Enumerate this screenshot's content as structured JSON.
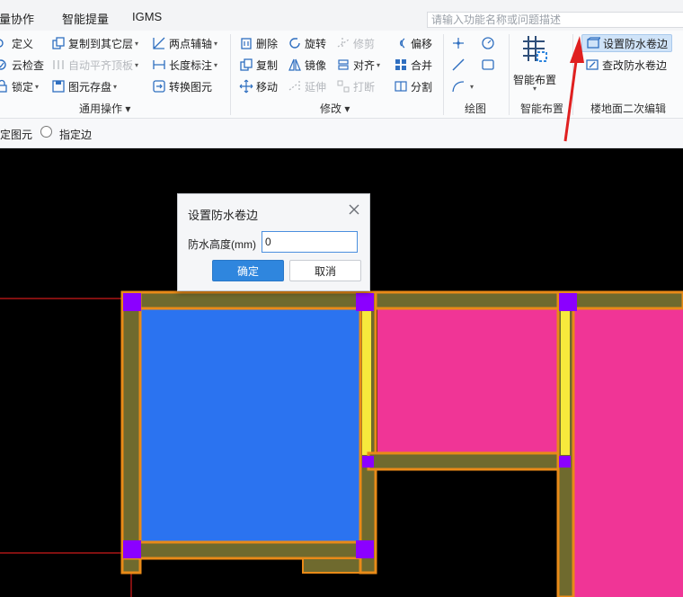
{
  "menu": {
    "tabs": [
      "算量协作",
      "智能提量",
      "IGMS"
    ],
    "search_placeholder": "请输入功能名称或问题描述"
  },
  "ribbon": {
    "general": {
      "define": "定义",
      "copy_to_floor": "复制到其它层",
      "two_point_axis": "两点辅轴",
      "cloud_check": "云检查",
      "auto_flat_slab": "自动平齐顶板",
      "length_label": "长度标注",
      "lock": "锁定",
      "element_storage": "图元存盘",
      "convert_element": "转换图元",
      "group_label": "通用操作"
    },
    "modify": {
      "delete": "删除",
      "rotate": "旋转",
      "trim": "修剪",
      "offset": "偏移",
      "copy": "复制",
      "mirror": "镜像",
      "align": "对齐",
      "merge": "合并",
      "move": "移动",
      "extend": "延伸",
      "break": "打断",
      "split": "分割",
      "group_label": "修改"
    },
    "draw": {
      "group_label": "绘图"
    },
    "smart": {
      "button_label": "智能布置",
      "group_label": "智能布置"
    },
    "floor": {
      "set_waterproof": "设置防水卷边",
      "edit_waterproof": "查改防水卷边",
      "group_label": "楼地面二次编辑"
    }
  },
  "option_bar": {
    "option1": "指定图元",
    "option2": "指定边"
  },
  "dialog": {
    "title": "设置防水卷边",
    "field_label": "防水高度(mm)",
    "field_value": "0",
    "ok": "确定",
    "cancel": "取消"
  },
  "colors": {
    "room_blue": "#2b73f0",
    "room_pink": "#f03596",
    "wall_olive": "#6f6a2e",
    "wall_orange": "#e98a18",
    "wall_yellow": "#f7e93c",
    "node_purple": "#8b00ff",
    "guide_red": "#ff2020",
    "annotation_red": "#e02020"
  }
}
